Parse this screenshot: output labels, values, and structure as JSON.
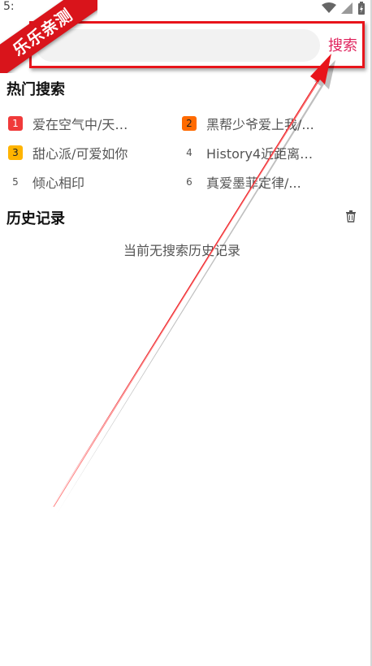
{
  "status": {
    "time": "5:"
  },
  "search": {
    "placeholder": "",
    "button_label": "搜索"
  },
  "hot": {
    "title": "热门搜索",
    "items": [
      {
        "rank": "1",
        "text": "爱在空气中/天…"
      },
      {
        "rank": "2",
        "text": "黑帮少爷爱上我/..."
      },
      {
        "rank": "3",
        "text": "甜心派/可爱如你"
      },
      {
        "rank": "4",
        "text": "History4近距离…"
      },
      {
        "rank": "5",
        "text": "倾心相印"
      },
      {
        "rank": "6",
        "text": "真爱墨菲定律/..."
      }
    ]
  },
  "history": {
    "title": "历史记录",
    "empty_text": "当前无搜索历史记录"
  },
  "watermark": {
    "text": "乐乐亲测"
  },
  "colors": {
    "accent": "#e0245e",
    "annotation": "#e8141b"
  }
}
